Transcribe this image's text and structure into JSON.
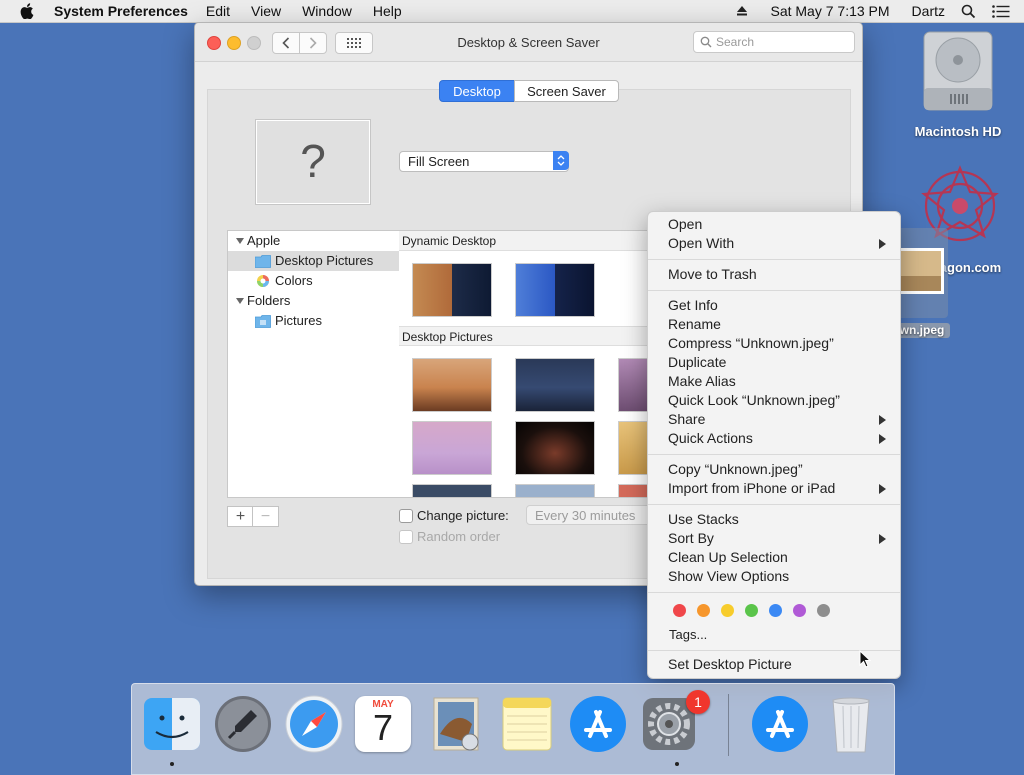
{
  "menubar": {
    "app_name": "System Preferences",
    "menus": [
      "Edit",
      "View",
      "Window",
      "Help"
    ],
    "datetime": "Sat May 7  7:13 PM",
    "user": "Dartz"
  },
  "window": {
    "title": "Desktop & Screen Saver",
    "search_placeholder": "Search",
    "tabs": [
      "Desktop",
      "Screen Saver"
    ],
    "preview_glyph": "?",
    "fit_option": "Fill Screen",
    "source_list": {
      "group_apple": "Apple",
      "item_desktop_pictures": "Desktop Pictures",
      "item_colors": "Colors",
      "group_folders": "Folders",
      "item_pictures": "Pictures"
    },
    "sections": {
      "dynamic": "Dynamic Desktop",
      "desktop_pictures": "Desktop Pictures"
    },
    "add_label": "+",
    "remove_label": "−",
    "change_picture_label": "Change picture:",
    "interval_value": "Every 30 minutes",
    "random_order_label": "Random order"
  },
  "desktop": {
    "hd_label": "Macintosh HD",
    "web_label": "Wagon.com",
    "file_label": "wn.jpeg"
  },
  "context_menu": {
    "open": "Open",
    "open_with": "Open With",
    "move_to_trash": "Move to Trash",
    "get_info": "Get Info",
    "rename": "Rename",
    "compress": "Compress “Unknown.jpeg”",
    "duplicate": "Duplicate",
    "make_alias": "Make Alias",
    "quick_look": "Quick Look “Unknown.jpeg”",
    "share": "Share",
    "quick_actions": "Quick Actions",
    "copy": "Copy “Unknown.jpeg”",
    "import": "Import from iPhone or iPad",
    "use_stacks": "Use Stacks",
    "sort_by": "Sort By",
    "clean_up": "Clean Up Selection",
    "show_view_options": "Show View Options",
    "tags": "Tags...",
    "set_desktop_picture": "Set Desktop Picture",
    "tag_colors": [
      "#f0474a",
      "#f6962c",
      "#f7cc2c",
      "#5ac44a",
      "#3b89f4",
      "#b05ad6",
      "#8e8e8e"
    ]
  },
  "dock": {
    "calendar_month": "MAY",
    "calendar_day": "7",
    "badge_count": "1"
  },
  "colors": {
    "accent": "#3b82f2",
    "desktop_bg": "#4a74b8"
  }
}
